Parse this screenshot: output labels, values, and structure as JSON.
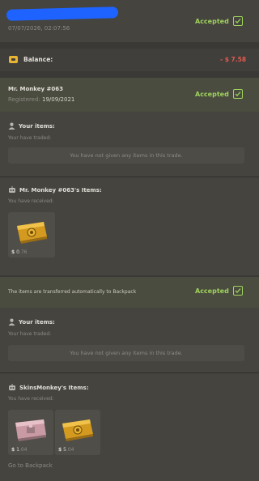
{
  "header": {
    "timestamp": "07/07/2026, 02:07:56",
    "status": "Accepted"
  },
  "balance": {
    "label": "Balance:",
    "amount": "- $ 7.58",
    "amount_color": "#e05a4f"
  },
  "trade1": {
    "user": "Mr. Monkey #063",
    "registered_label": "Registered:",
    "registered_date": "19/09/2021",
    "status": "Accepted",
    "your_items": {
      "title": "Your items:",
      "subtitle": "Your have traded:",
      "empty": "You have not given any items in this trade."
    },
    "received": {
      "title": "Mr. Monkey #063's Items:",
      "subtitle": "You have received:",
      "items": [
        {
          "icon": "golden-case-icon",
          "price": "0",
          "cents": ".76"
        }
      ]
    }
  },
  "trade2": {
    "notice": "The items are transferred automatically to Backpack",
    "status": "Accepted",
    "your_items": {
      "title": "Your items:",
      "subtitle": "Your have traded:",
      "empty": "You have not given any items in this trade."
    },
    "received": {
      "title": "SkinsMonkey's Items:",
      "subtitle": "You have received:",
      "items": [
        {
          "icon": "pink-case-icon",
          "price": "1",
          "cents": ".04"
        },
        {
          "icon": "golden-case-icon",
          "price": "5",
          "cents": ".04"
        }
      ]
    }
  },
  "footer": {
    "link": "Go to Backpack"
  },
  "colors": {
    "accent_green": "#9fd25c",
    "negative_red": "#e05a4f",
    "wallet_yellow": "#e8b431"
  }
}
